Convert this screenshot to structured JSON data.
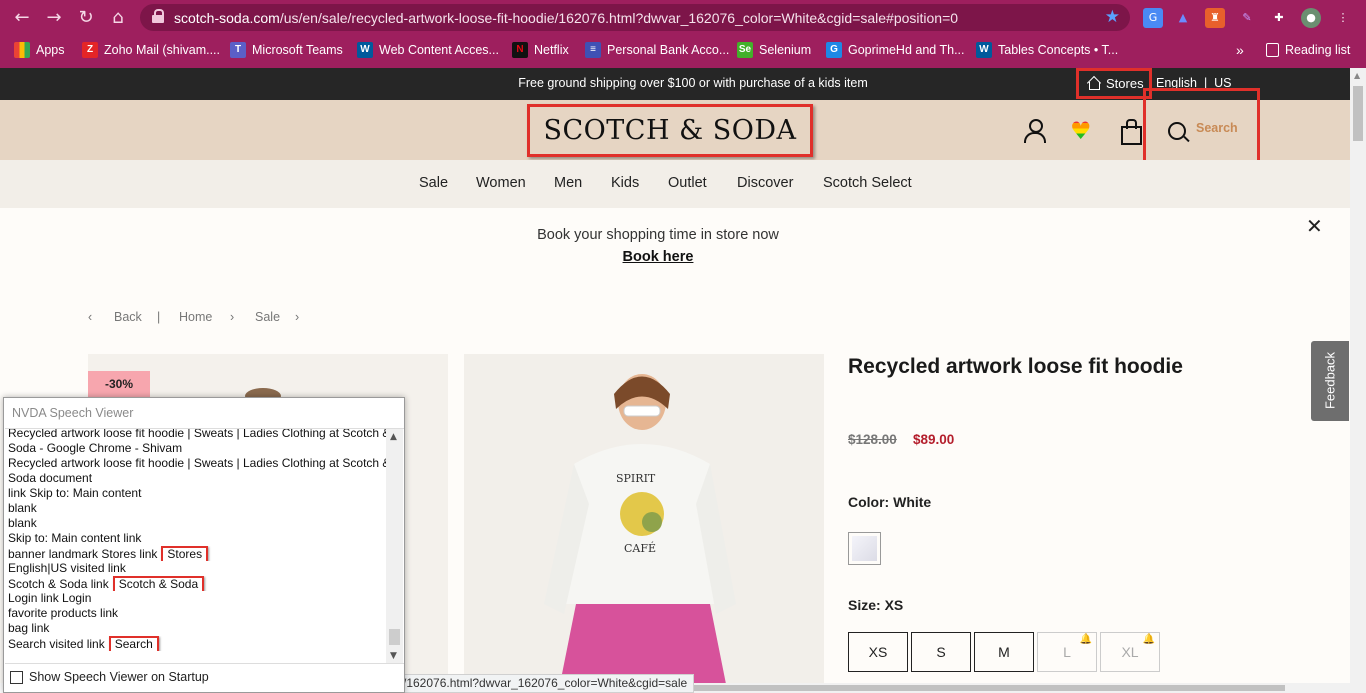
{
  "browser": {
    "url_host": "scotch-soda.com",
    "url_path": "/us/en/sale/recycled-artwork-loose-fit-hoodie/162076.html?dwvar_162076_color=White&cgid=sale#position=0",
    "bookmarks": [
      {
        "label": "Apps",
        "color": "#f4b400"
      },
      {
        "label": "Zoho Mail (shivam....",
        "color": "#e42527"
      },
      {
        "label": "Microsoft Teams",
        "color": "#5b5fc7"
      },
      {
        "label": "Web Content Acces...",
        "color": "#005a9c"
      },
      {
        "label": "Netflix",
        "color": "#e50914"
      },
      {
        "label": "Personal Bank Acco...",
        "color": "#3f51b5"
      },
      {
        "label": "Selenium",
        "color": "#43b02a"
      },
      {
        "label": "GoprimeHd and Th...",
        "color": "#1e88e5"
      },
      {
        "label": "Tables Concepts • T...",
        "color": "#005a9c"
      }
    ],
    "reading_list": "Reading list",
    "more": "»"
  },
  "site": {
    "promo": "Free ground shipping over $100 or with purchase of a kids item",
    "stores": "Stores",
    "lang": "English  |  US",
    "logo": "SCOTCH & SODA",
    "search": "Search",
    "nav": [
      "Sale",
      "Women",
      "Men",
      "Kids",
      "Outlet",
      "Discover",
      "Scotch Select"
    ],
    "booking_line1": "Book your shopping time in store now",
    "booking_line2": "Book here",
    "close": "✕",
    "breadcrumbs": {
      "back": "Back",
      "sep": "|",
      "home": "Home",
      "sale": "Sale"
    },
    "badge": "-30%",
    "product": {
      "title": "Recycled artwork loose fit hoodie",
      "old_price": "$128.00",
      "new_price": "$89.00",
      "color_label": "Color: White",
      "size_label": "Size: XS",
      "sizes": [
        {
          "label": "XS",
          "available": true
        },
        {
          "label": "S",
          "available": true
        },
        {
          "label": "M",
          "available": true
        },
        {
          "label": "L",
          "available": false
        },
        {
          "label": "XL",
          "available": false
        }
      ]
    },
    "feedback": "Feedback",
    "status_url": "/162076.html?dwvar_162076_color=White&cgid=sale"
  },
  "nvda": {
    "title": "NVDA Speech Viewer",
    "lines": [
      "Recycled artwork loose fit hoodie | Sweats | Ladies Clothing at Scotch &",
      "Soda - Google Chrome - Shivam",
      "Recycled artwork loose fit hoodie | Sweats | Ladies Clothing at Scotch &",
      "Soda  document",
      "link    Skip to: Main content",
      "blank",
      "blank",
      "Skip to: Main content  link"
    ],
    "hl_lines": [
      {
        "text": "banner landmark    Stores  link",
        "tag": "Stores"
      },
      {
        "text": "English|US  visited  link",
        "tag": ""
      },
      {
        "text": "Scotch & Soda  link",
        "tag": "Scotch & Soda"
      },
      {
        "text": "Login  link    Login",
        "tag": ""
      },
      {
        "text": "favorite products  link",
        "tag": ""
      },
      {
        "text": "bag  link",
        "tag": ""
      },
      {
        "text": "Search  visited  link",
        "tag": "Search"
      }
    ],
    "footer": "Show Speech Viewer on Startup"
  },
  "colors": {
    "chrome": "#9e1f5e",
    "header": "#e6d5c3",
    "sale_price": "#b41e2c",
    "highlight": "#e0302a"
  }
}
